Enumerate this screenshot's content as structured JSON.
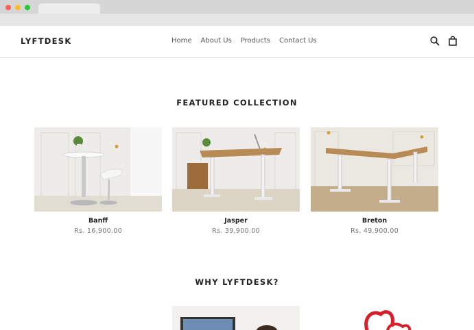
{
  "store": {
    "logo": "LYFTDESK"
  },
  "nav": [
    {
      "label": "Home"
    },
    {
      "label": "About Us"
    },
    {
      "label": "Products"
    },
    {
      "label": "Contact Us"
    }
  ],
  "icons": {
    "search": "search-icon",
    "cart": "cart-icon"
  },
  "featured": {
    "title": "FEATURED COLLECTION",
    "products": [
      {
        "name": "Banff",
        "price": "Rs. 16,900.00"
      },
      {
        "name": "Jasper",
        "price": "Rs. 39,900.00"
      },
      {
        "name": "Breton",
        "price": "Rs. 49,900.00"
      }
    ]
  },
  "why": {
    "title": "WHY LYFTDESK?"
  },
  "colors": {
    "red_dot": "#fe5f57",
    "yellow_dot": "#febc2e",
    "green_dot": "#28c840",
    "wood": "#b88a55"
  }
}
